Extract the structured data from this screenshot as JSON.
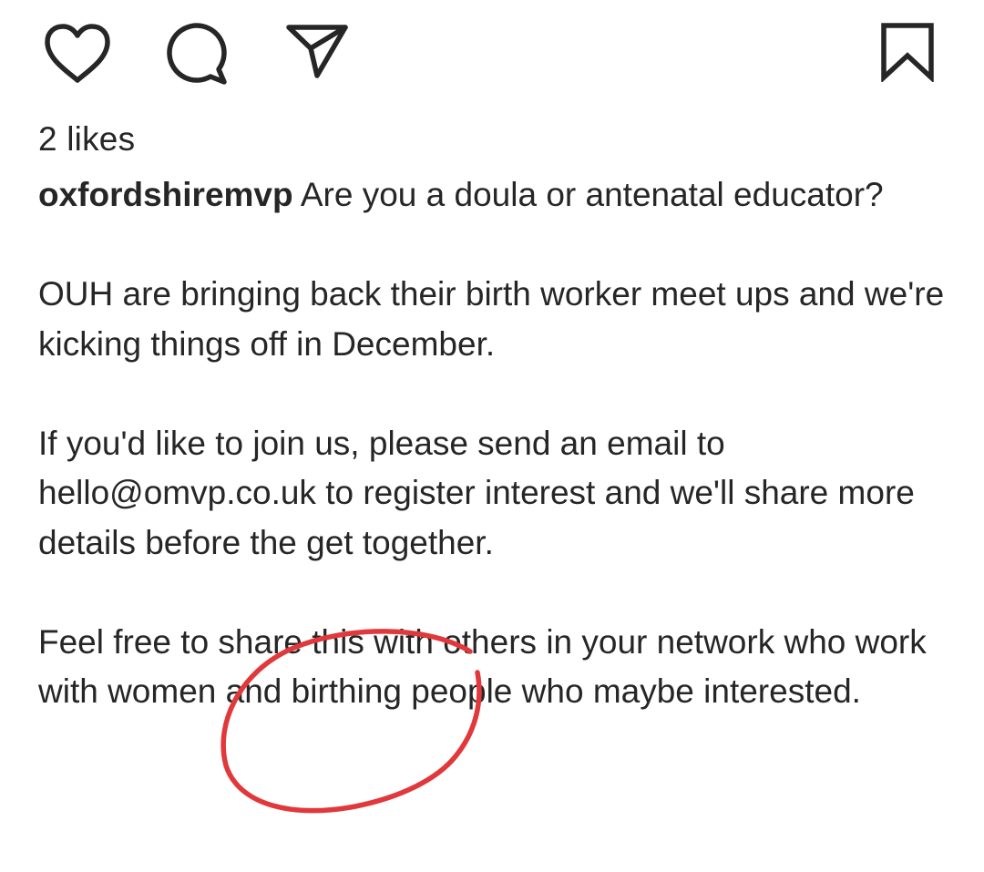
{
  "actions": {
    "like_icon": "heart-icon",
    "comment_icon": "comment-bubble-icon",
    "share_icon": "paper-plane-icon",
    "save_icon": "bookmark-icon"
  },
  "likes_text": "2 likes",
  "caption": {
    "username": "oxfordshiremvp",
    "paragraphs": [
      "Are you a doula or antenatal educator?",
      "OUH are bringing back their birth worker meet ups and we're kicking things off in December.",
      "If you'd like to join us, please send an email to hello@omvp.co.uk to register interest and we'll share more details before the get together.",
      "Feel free to share this with others in your network who work with women and birthing people who maybe interested."
    ]
  },
  "annotation": {
    "shape": "hand-drawn circle",
    "color": "#e0383b"
  }
}
